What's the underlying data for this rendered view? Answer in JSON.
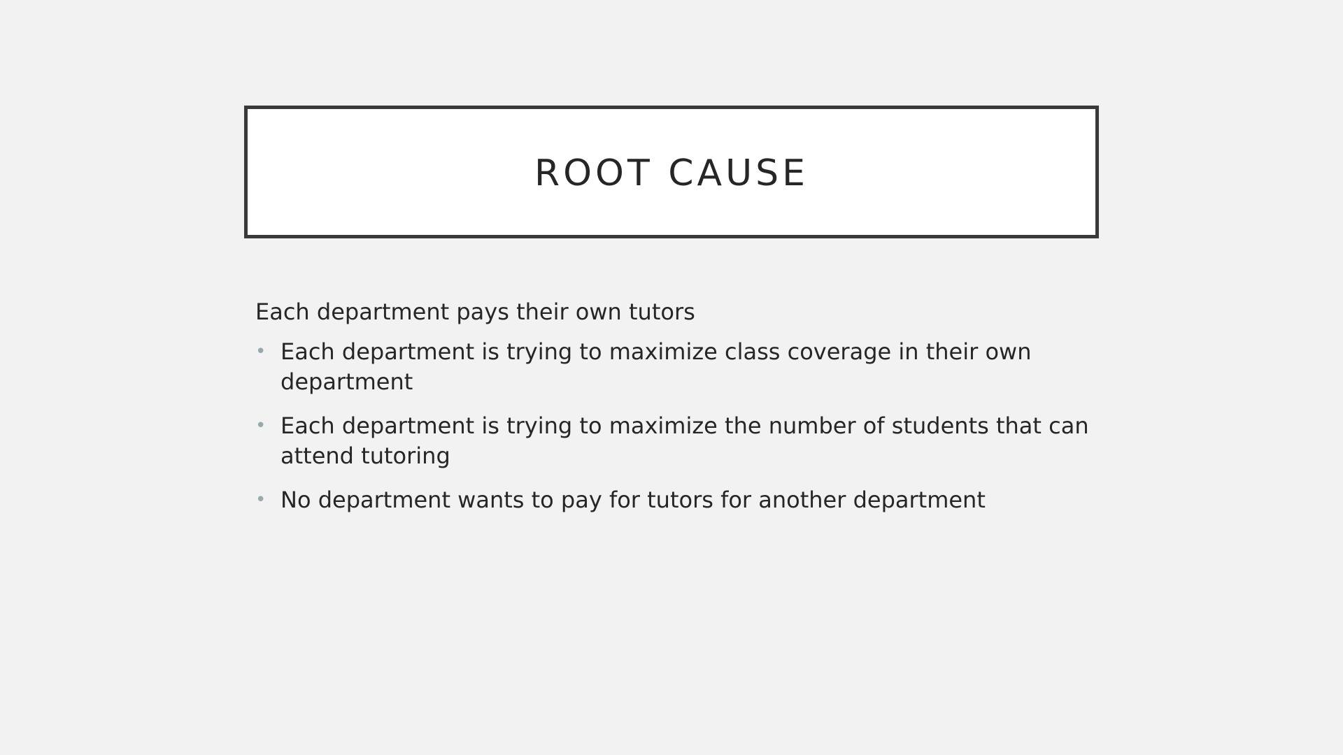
{
  "slide": {
    "title": "ROOT CAUSE",
    "intro": "Each department pays their own tutors",
    "bullets": [
      "Each department is trying to maximize class coverage in their own department",
      "Each department is trying to maximize the number of students that can attend tutoring",
      "No department wants to pay for tutors for another department"
    ],
    "bullet_glyph": "•"
  },
  "colors": {
    "background": "#f2f2f2",
    "title_border": "#3a3a3a",
    "text": "#262626",
    "bullet": "#96a9ad"
  }
}
